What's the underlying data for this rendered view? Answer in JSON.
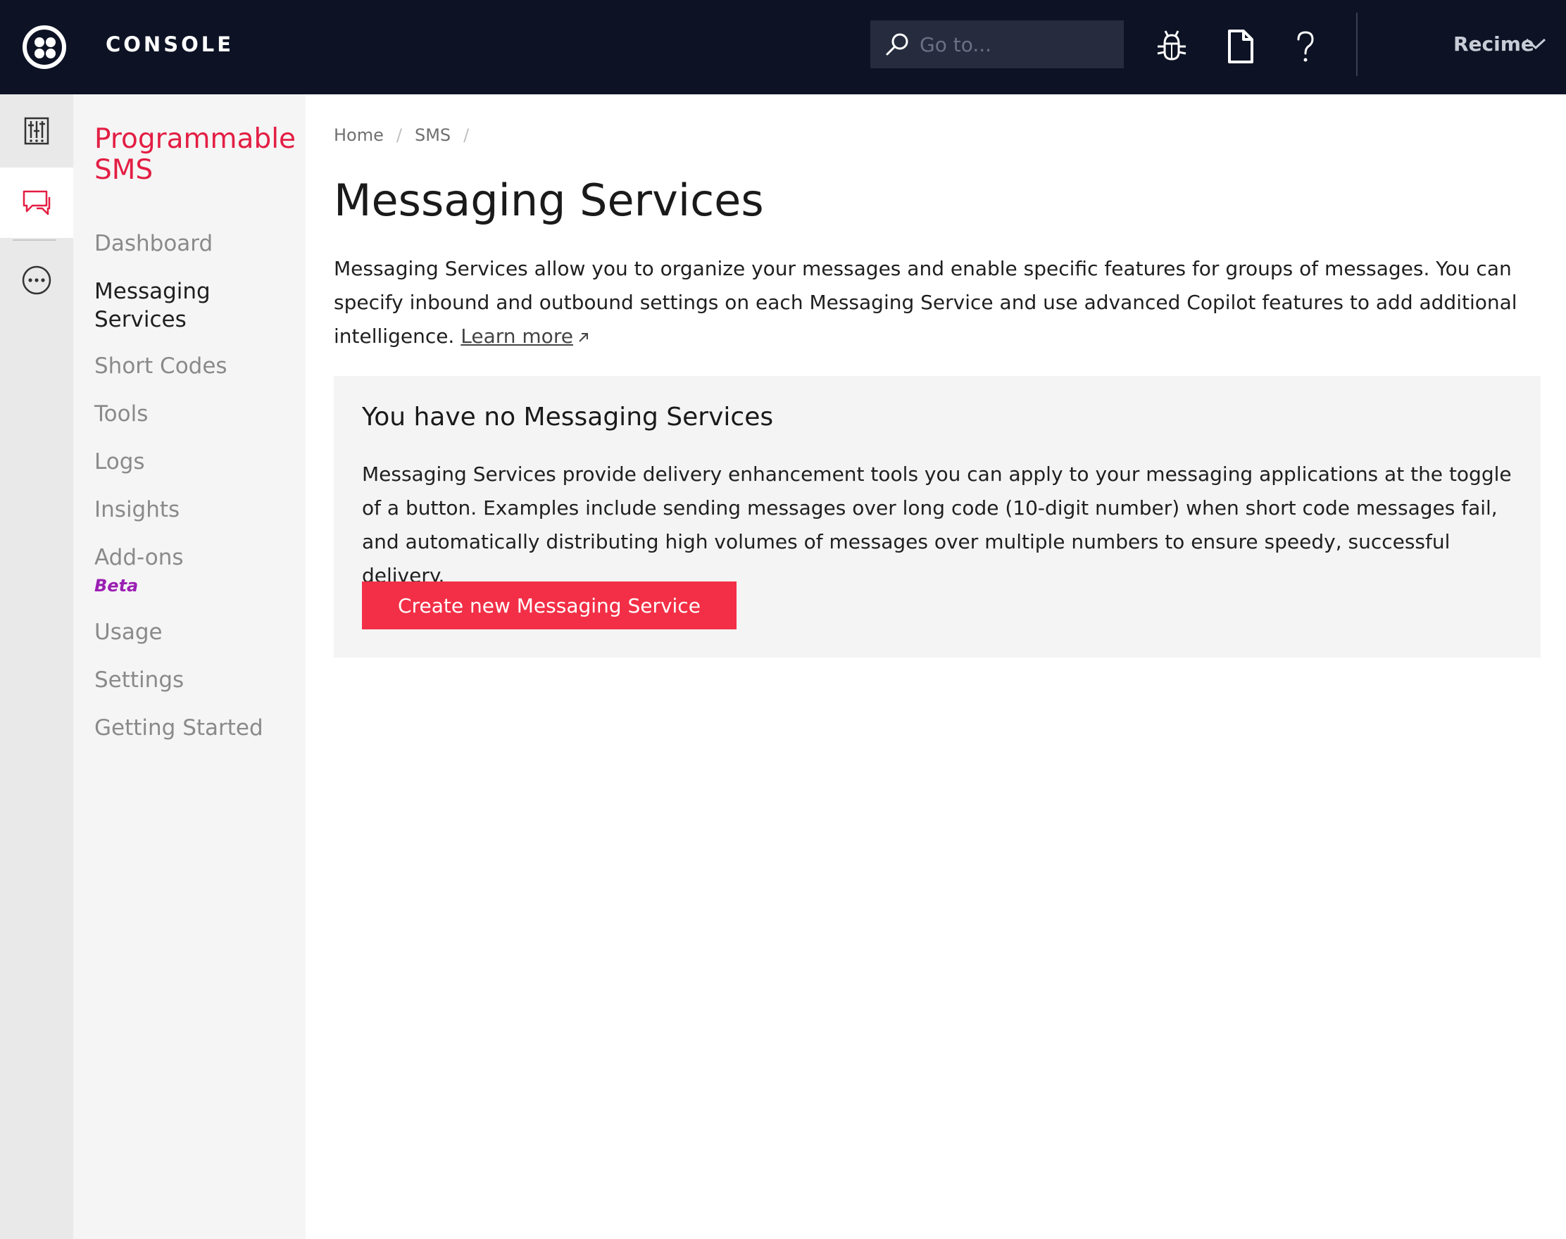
{
  "topbar": {
    "app_title": "CONSOLE",
    "search_placeholder": "Go to...",
    "account_name": "Recime",
    "icons": [
      "debugger-icon",
      "docs-icon",
      "help-icon"
    ]
  },
  "product": {
    "title": "Programmable SMS"
  },
  "subnav": {
    "items": [
      {
        "label": "Dashboard"
      },
      {
        "label": "Messaging Services",
        "active": true
      },
      {
        "label": "Short Codes"
      },
      {
        "label": "Tools"
      },
      {
        "label": "Logs"
      },
      {
        "label": "Insights"
      },
      {
        "label": "Add-ons",
        "badge": "Beta"
      },
      {
        "label": "Usage"
      },
      {
        "label": "Settings"
      },
      {
        "label": "Getting Started"
      }
    ]
  },
  "breadcrumb": [
    "Home",
    "SMS"
  ],
  "page": {
    "title": "Messaging Services",
    "intro": "Messaging Services allow you to organize your messages and enable specific features for groups of messages. You can specify inbound and outbound settings on each Messaging Service and use advanced Copilot features to add additional intelligence.",
    "learn_more": "Learn more"
  },
  "empty_state": {
    "title": "You have no Messaging Services",
    "description": "Messaging Services provide delivery enhancement tools you can apply to your messaging applications at the toggle of a button. Examples include sending messages over long code (10-digit number) when short code messages fail, and automatically distributing high volumes of messages over multiple numbers to ensure speedy, successful delivery.",
    "button_label": "Create new Messaging Service"
  },
  "colors": {
    "topbar_bg": "#0d1325",
    "brand_red": "#f22f46",
    "product_title": "#e31e43",
    "beta": "#9b1fb3"
  }
}
